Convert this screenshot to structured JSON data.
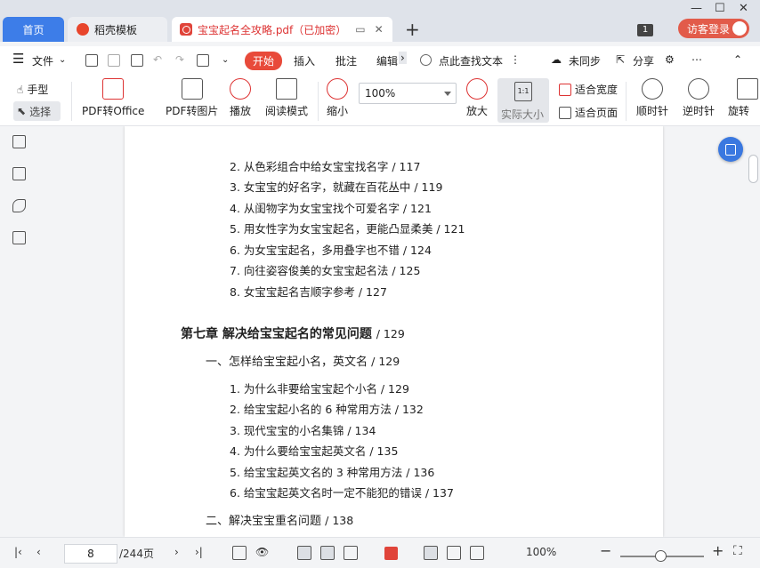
{
  "tabs": {
    "home": "首页",
    "template": "稻壳模板",
    "doc": "宝宝起名全攻略.pdf（已加密）"
  },
  "window": {
    "count": "1",
    "login": "访客登录"
  },
  "menu": {
    "file": "文件",
    "start": "开始",
    "insert": "插入",
    "annotate": "批注",
    "edit": "编辑",
    "search_placeholder": "点此查找文本",
    "sync": "未同步",
    "share": "分享"
  },
  "toolbar": {
    "hand": "手型",
    "select": "选择",
    "pdf_to_office": "PDF转Office",
    "pdf_to_image": "PDF转图片",
    "play": "播放",
    "read_mode": "阅读模式",
    "zoom_out": "缩小",
    "zoom_value": "100%",
    "zoom_in": "放大",
    "actual_size": "实际大小",
    "fit_width": "适合宽度",
    "fit_page": "适合页面",
    "rotate_cw": "顺时针",
    "rotate_ccw": "逆时针",
    "rotate": "旋转"
  },
  "document": {
    "items_top": [
      "2. 从色彩组合中给女宝宝找名字 / 117",
      "3. 女宝宝的好名字，就藏在百花丛中 / 119",
      "4. 从闺物字为女宝宝找个可爱名字 / 121",
      "5. 用女性字为女宝宝起名，更能凸显柔美 / 121",
      "6. 为女宝宝起名，多用叠字也不错 / 124",
      "7. 向往姿容俊美的女宝宝起名法 / 125",
      "8. 女宝宝起名吉顺字参考 / 127"
    ],
    "chapter_title": "第七章  解决给宝宝起名的常见问题",
    "chapter_page": "/ 129",
    "section1_title": "一、怎样给宝宝起小名，英文名",
    "section1_page": "/ 129",
    "items_section1": [
      "1. 为什么非要给宝宝起个小名 / 129",
      "2. 给宝宝起小名的 6 种常用方法 / 132",
      "3. 现代宝宝的小名集锦 / 134",
      "4. 为什么要给宝宝起英文名 / 135",
      "5. 给宝宝起英文名的 3 种常用方法 / 136",
      "6. 给宝宝起英文名时一定不能犯的错误 / 137"
    ],
    "section2_title": "二、解决宝宝重名问题",
    "section2_page": "/ 138"
  },
  "status": {
    "current_page": "8",
    "total_pages": "/244页",
    "zoom": "100%"
  }
}
